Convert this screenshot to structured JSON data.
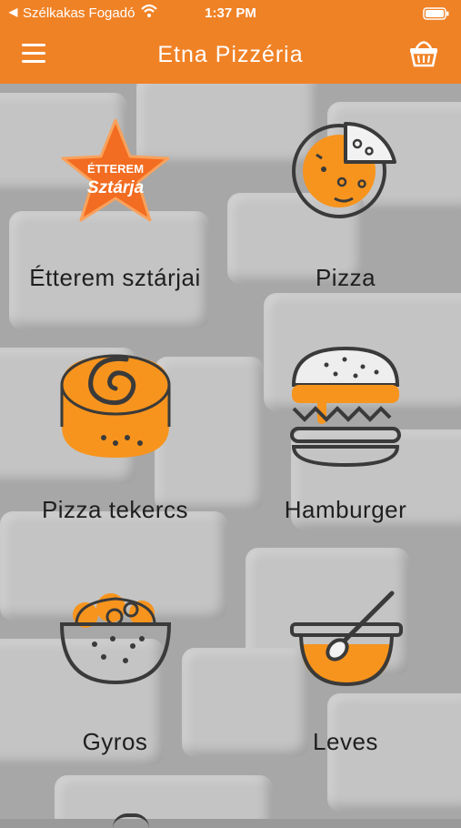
{
  "status_bar": {
    "back_indicator": "◀",
    "carrier": "Szélkakas Fogadó",
    "time": "1:37 PM",
    "wifi_icon": "wifi-icon",
    "battery_icon": "battery-icon"
  },
  "header": {
    "title": "Etna Pizzéria",
    "menu_icon": "hamburger-menu-icon",
    "cart_icon": "basket-icon"
  },
  "star_badge": {
    "line1": "ÉTTEREM",
    "line2": "Sztárja"
  },
  "categories": [
    {
      "label": "Étterem sztárjai",
      "icon": "star-badge-icon"
    },
    {
      "label": "Pizza",
      "icon": "pizza-icon"
    },
    {
      "label": "Pizza tekercs",
      "icon": "pizza-roll-icon"
    },
    {
      "label": "Hamburger",
      "icon": "hamburger-icon"
    },
    {
      "label": "Gyros",
      "icon": "gyros-bowl-icon"
    },
    {
      "label": "Leves",
      "icon": "soup-bowl-icon"
    }
  ],
  "colors": {
    "accent": "#f08226",
    "icon_orange": "#f7941d",
    "icon_stroke": "#3a3a3a"
  }
}
